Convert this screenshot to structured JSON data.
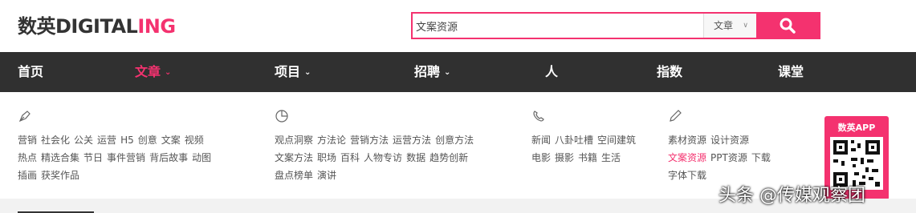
{
  "logo": {
    "text_main": "数英DIGITAL",
    "text_accent": "ING"
  },
  "search": {
    "value": "文案资源",
    "category": "文章"
  },
  "nav": {
    "items": [
      {
        "label": "首页"
      },
      {
        "label": "文章"
      },
      {
        "label": "项目"
      },
      {
        "label": "招聘"
      },
      {
        "label": "人"
      },
      {
        "label": "指数"
      },
      {
        "label": "课堂"
      }
    ]
  },
  "submenu": {
    "col1": {
      "icon": "pen-nib-icon",
      "rows": [
        [
          "营销",
          "社会化",
          "公关",
          "运营",
          "H5",
          "创意",
          "文案",
          "视频"
        ],
        [
          "热点",
          "精选合集",
          "节日",
          "事件营销",
          "背后故事",
          "动图"
        ],
        [
          "插画",
          "获奖作品"
        ]
      ]
    },
    "col2": {
      "icon": "pie-chart-icon",
      "rows": [
        [
          "观点洞察",
          "方法论",
          "营销方法",
          "运营方法",
          "创意方法"
        ],
        [
          "文案方法",
          "职场",
          "百科",
          "人物专访",
          "数据",
          "趋势创新"
        ],
        [
          "盘点榜单",
          "演讲"
        ]
      ]
    },
    "col3": {
      "icon": "phone-icon",
      "rows": [
        [
          "新闻",
          "八卦吐槽",
          "空间建筑"
        ],
        [
          "电影",
          "摄影",
          "书籍",
          "生活"
        ]
      ]
    },
    "col4": {
      "icon": "pencil-icon",
      "rows": [
        [
          "素材资源",
          "设计资源"
        ],
        [
          "文案资源",
          "PPT资源",
          "下载"
        ],
        [
          "字体下载"
        ]
      ]
    }
  },
  "app": {
    "label": "数英APP"
  },
  "watermark": {
    "text": "头条 @传媒观察团"
  },
  "colors": {
    "accent": "#f4326f",
    "nav_bg": "#303030"
  }
}
